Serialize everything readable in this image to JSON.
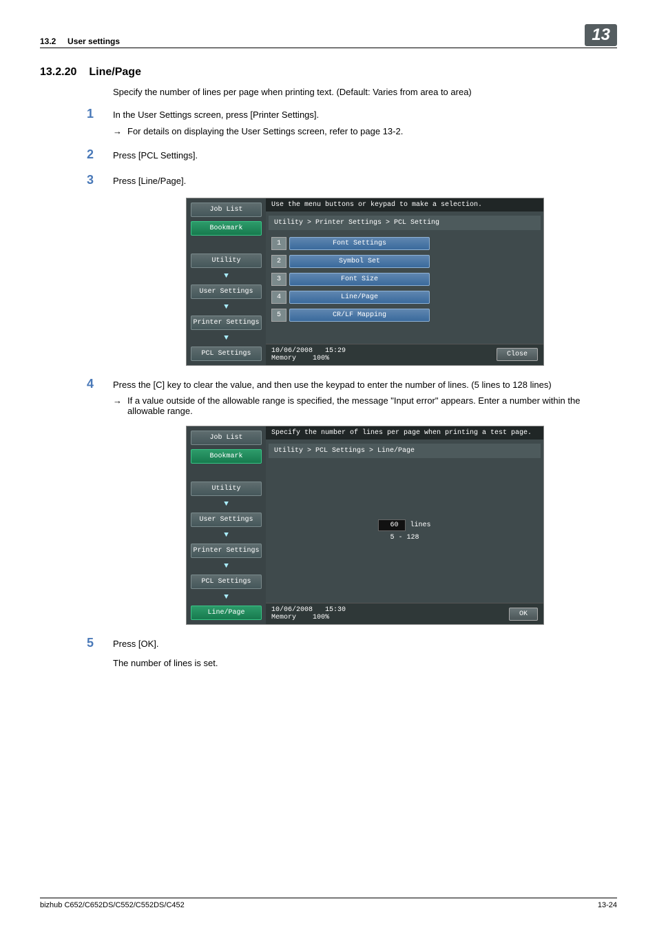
{
  "header": {
    "section_ref": "13.2",
    "section_label": "User settings",
    "chapter": "13"
  },
  "section": {
    "number": "13.2.20",
    "title": "Line/Page",
    "intro": "Specify the number of lines per page when printing text. (Default: Varies from area to area)"
  },
  "steps": {
    "s1": {
      "num": "1",
      "text": "In the User Settings screen, press [Printer Settings].",
      "sub_arrow": "→",
      "sub_text": "For details on displaying the User Settings screen, refer to page 13-2."
    },
    "s2": {
      "num": "2",
      "text": "Press [PCL Settings]."
    },
    "s3": {
      "num": "3",
      "text": "Press [Line/Page]."
    },
    "s4": {
      "num": "4",
      "text": "Press the [C] key to clear the value, and then use the keypad to enter the number of lines. (5 lines to 128 lines)",
      "sub_arrow": "→",
      "sub_text": "If a value outside of the allowable range is specified, the message \"Input error\" appears. Enter a number within the allowable range."
    },
    "s5": {
      "num": "5",
      "text": "Press [OK].",
      "after": "The number of lines is set."
    }
  },
  "screenshot1": {
    "instruction": "Use the menu buttons or keypad to make a selection.",
    "breadcrumb": "Utility > Printer Settings > PCL Setting",
    "tabs": {
      "job_list": "Job List",
      "bookmark": "Bookmark",
      "utility": "Utility",
      "user_settings": "User Settings",
      "printer_settings": "Printer Settings",
      "pcl_settings": "PCL Settings"
    },
    "menu": [
      {
        "n": "1",
        "label": "Font Settings"
      },
      {
        "n": "2",
        "label": "Symbol Set"
      },
      {
        "n": "3",
        "label": "Font Size"
      },
      {
        "n": "4",
        "label": "Line/Page"
      },
      {
        "n": "5",
        "label": "CR/LF Mapping"
      }
    ],
    "status": {
      "date": "10/06/2008",
      "time": "15:29",
      "mem_label": "Memory",
      "mem_val": "100%"
    },
    "close": "Close"
  },
  "screenshot2": {
    "instruction": "Specify the number of lines per page when printing a test page.",
    "breadcrumb": "Utility > PCL Settings > Line/Page",
    "tabs": {
      "job_list": "Job List",
      "bookmark": "Bookmark",
      "utility": "Utility",
      "user_settings": "User Settings",
      "printer_settings": "Printer Settings",
      "pcl_settings": "PCL Settings",
      "line_page": "Line/Page"
    },
    "value": "60",
    "unit": "lines",
    "range": "5 - 128",
    "status": {
      "date": "10/06/2008",
      "time": "15:30",
      "mem_label": "Memory",
      "mem_val": "100%"
    },
    "ok": "OK"
  },
  "footer": {
    "model": "bizhub C652/C652DS/C552/C552DS/C452",
    "page": "13-24"
  }
}
